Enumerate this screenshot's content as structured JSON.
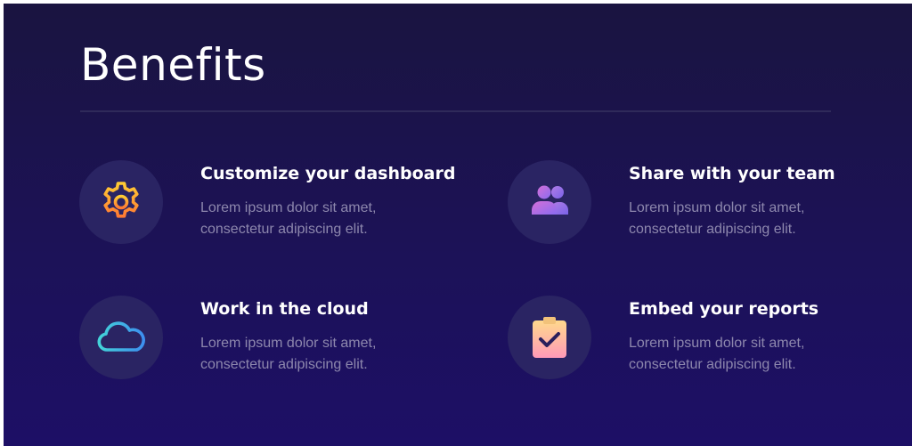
{
  "header": {
    "title": "Benefits"
  },
  "benefits": [
    {
      "title": "Customize your dashboard",
      "desc": "Lorem ipsum dolor sit amet, consectetur adipiscing elit.",
      "icon": "gear-icon"
    },
    {
      "title": "Share with your team",
      "desc": "Lorem ipsum dolor sit amet, consectetur adipiscing elit.",
      "icon": "team-icon"
    },
    {
      "title": "Work in the cloud",
      "desc": "Lorem ipsum dolor sit amet, consectetur adipiscing elit.",
      "icon": "cloud-icon"
    },
    {
      "title": "Embed your reports",
      "desc": "Lorem ipsum dolor sit amet, consectetur adipiscing elit.",
      "icon": "clipboard-check-icon"
    }
  ],
  "colors": {
    "background_top": "#1a1440",
    "background_bottom": "#1d0f66",
    "icon_circle": "#2a2463",
    "description_text": "#8d87ad",
    "gear_gradient": [
      "#ffcc33",
      "#ff7a33"
    ],
    "team_gradient": [
      "#d46fd8",
      "#8a6cf0"
    ],
    "cloud_gradient": [
      "#43d3d8",
      "#3d8ff0"
    ],
    "clipboard_gradient": [
      "#ffd98c",
      "#ff9ab8"
    ]
  }
}
